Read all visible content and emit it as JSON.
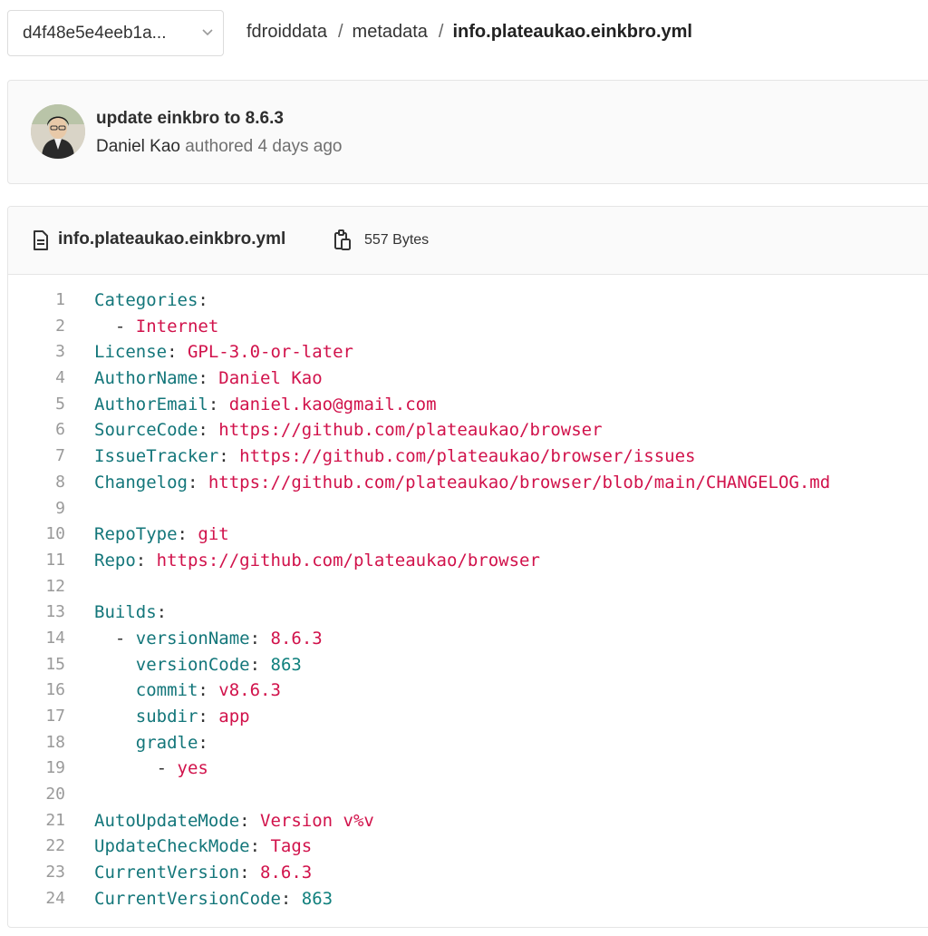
{
  "ref_selector": {
    "label": "d4f48e5e4eeb1a...",
    "icon": "chevron-down-icon"
  },
  "breadcrumb": {
    "items": [
      "fdroiddata",
      "metadata"
    ],
    "separator": "/",
    "current": "info.plateaukao.einkbro.yml"
  },
  "commit": {
    "title": "update einkbro to 8.6.3",
    "author": "Daniel Kao",
    "action": "authored",
    "time": "4 days ago"
  },
  "file": {
    "icon": "file-text-icon",
    "name": "info.plateaukao.einkbro.yml",
    "copy_icon": "copy-path-icon",
    "size": "557 Bytes"
  },
  "colors": {
    "key": "#13767a",
    "value": "#d1124b",
    "number": "#10807d",
    "line_number": "#9a9a9a"
  },
  "code_lines": [
    {
      "n": "1",
      "indent": "",
      "dash": "",
      "key": "Categories",
      "val": "",
      "type": ""
    },
    {
      "n": "2",
      "indent": "  ",
      "dash": "- ",
      "key": "",
      "val": "Internet",
      "type": "str"
    },
    {
      "n": "3",
      "indent": "",
      "dash": "",
      "key": "License",
      "val": "GPL-3.0-or-later",
      "type": "str"
    },
    {
      "n": "4",
      "indent": "",
      "dash": "",
      "key": "AuthorName",
      "val": "Daniel Kao",
      "type": "str"
    },
    {
      "n": "5",
      "indent": "",
      "dash": "",
      "key": "AuthorEmail",
      "val": "daniel.kao@gmail.com",
      "type": "str"
    },
    {
      "n": "6",
      "indent": "",
      "dash": "",
      "key": "SourceCode",
      "val": "https://github.com/plateaukao/browser",
      "type": "str"
    },
    {
      "n": "7",
      "indent": "",
      "dash": "",
      "key": "IssueTracker",
      "val": "https://github.com/plateaukao/browser/issues",
      "type": "str"
    },
    {
      "n": "8",
      "indent": "",
      "dash": "",
      "key": "Changelog",
      "val": "https://github.com/plateaukao/browser/blob/main/CHANGELOG.md",
      "type": "str"
    },
    {
      "n": "9",
      "indent": "",
      "dash": "",
      "key": "",
      "val": "",
      "type": ""
    },
    {
      "n": "10",
      "indent": "",
      "dash": "",
      "key": "RepoType",
      "val": "git",
      "type": "str"
    },
    {
      "n": "11",
      "indent": "",
      "dash": "",
      "key": "Repo",
      "val": "https://github.com/plateaukao/browser",
      "type": "str"
    },
    {
      "n": "12",
      "indent": "",
      "dash": "",
      "key": "",
      "val": "",
      "type": ""
    },
    {
      "n": "13",
      "indent": "",
      "dash": "",
      "key": "Builds",
      "val": "",
      "type": ""
    },
    {
      "n": "14",
      "indent": "  ",
      "dash": "- ",
      "key": "versionName",
      "val": "8.6.3",
      "type": "str"
    },
    {
      "n": "15",
      "indent": "    ",
      "dash": "",
      "key": "versionCode",
      "val": "863",
      "type": "num"
    },
    {
      "n": "16",
      "indent": "    ",
      "dash": "",
      "key": "commit",
      "val": "v8.6.3",
      "type": "str"
    },
    {
      "n": "17",
      "indent": "    ",
      "dash": "",
      "key": "subdir",
      "val": "app",
      "type": "str"
    },
    {
      "n": "18",
      "indent": "    ",
      "dash": "",
      "key": "gradle",
      "val": "",
      "type": ""
    },
    {
      "n": "19",
      "indent": "      ",
      "dash": "- ",
      "key": "",
      "val": "yes",
      "type": "str"
    },
    {
      "n": "20",
      "indent": "",
      "dash": "",
      "key": "",
      "val": "",
      "type": ""
    },
    {
      "n": "21",
      "indent": "",
      "dash": "",
      "key": "AutoUpdateMode",
      "val": "Version v%v",
      "type": "str"
    },
    {
      "n": "22",
      "indent": "",
      "dash": "",
      "key": "UpdateCheckMode",
      "val": "Tags",
      "type": "str"
    },
    {
      "n": "23",
      "indent": "",
      "dash": "",
      "key": "CurrentVersion",
      "val": "8.6.3",
      "type": "str"
    },
    {
      "n": "24",
      "indent": "",
      "dash": "",
      "key": "CurrentVersionCode",
      "val": "863",
      "type": "num"
    }
  ]
}
